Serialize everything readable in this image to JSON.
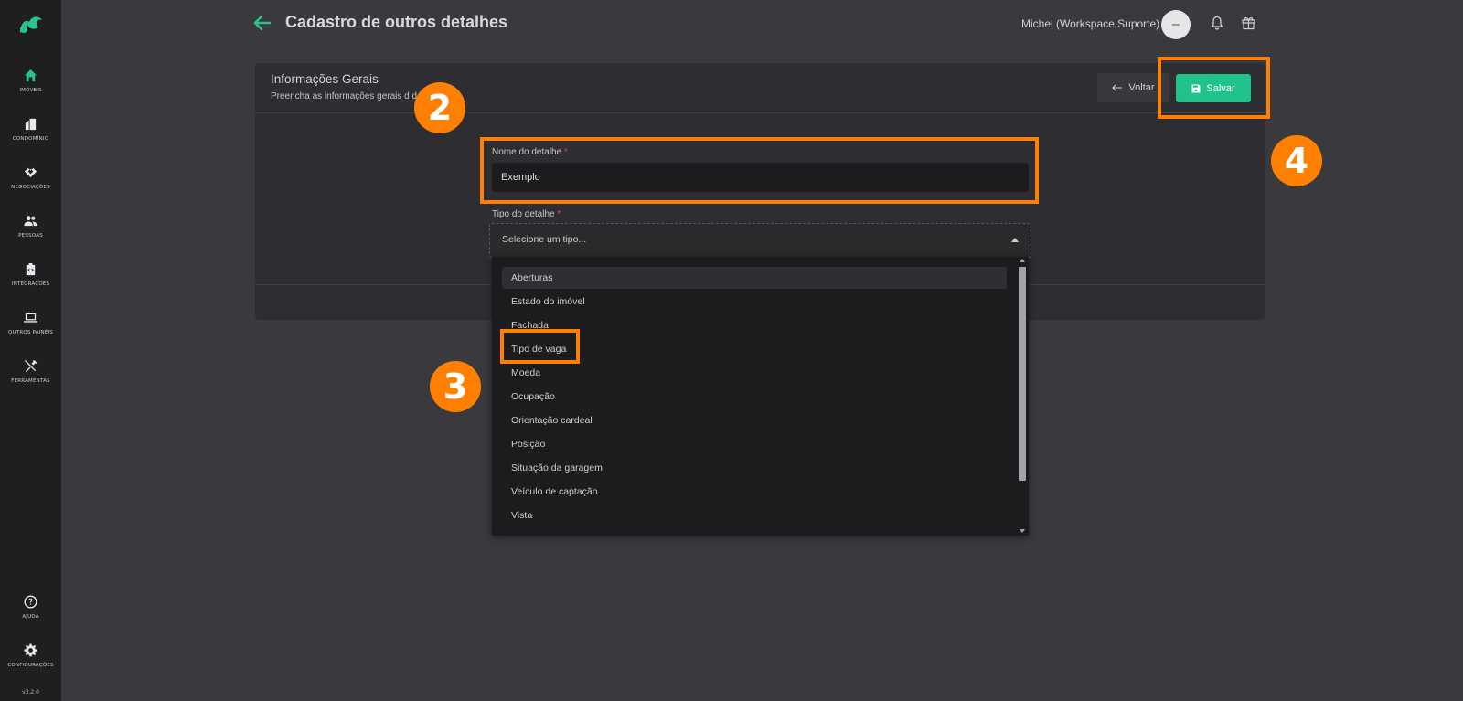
{
  "sidebar": {
    "items": [
      {
        "label": "IMÓVEIS",
        "icon": "home-icon"
      },
      {
        "label": "CONDOMÍNIO",
        "icon": "building-icon"
      },
      {
        "label": "NEGOCIAÇÕES",
        "icon": "handshake-icon"
      },
      {
        "label": "PESSOAS",
        "icon": "people-icon"
      },
      {
        "label": "INTEGRAÇÕES",
        "icon": "integration-icon"
      },
      {
        "label": "OUTROS PAINÉIS",
        "icon": "laptop-icon"
      },
      {
        "label": "FERRAMENTAS",
        "icon": "tools-icon"
      }
    ],
    "bottom": [
      {
        "label": "AJUDA",
        "icon": "help-icon"
      },
      {
        "label": "CONFIGURAÇÕES",
        "icon": "gear-icon"
      }
    ],
    "version": "v3.2.0"
  },
  "header": {
    "title": "Cadastro de outros detalhes",
    "user": "Michel (Workspace Suporte)"
  },
  "card": {
    "title": "Informações Gerais",
    "subtitle": "Preencha as informações gerais d          detalhe",
    "back_label": "Voltar",
    "save_label": "Salvar"
  },
  "form": {
    "name_label": "Nome do detalhe",
    "name_value": "Exemplo",
    "type_label": "Tipo do detalhe",
    "required_mark": "*",
    "type_placeholder": "Selecione um tipo...",
    "options": [
      "Aberturas",
      "Estado do imóvel",
      "Fachada",
      "Tipo de vaga",
      "Moeda",
      "Ocupação",
      "Orientação cardeal",
      "Posição",
      "Situação da garagem",
      "Veículo de captação",
      "Vista"
    ]
  },
  "annotations": {
    "two": "2",
    "three": "3",
    "four": "4"
  },
  "colors": {
    "accent": "#1fc28a",
    "highlight": "#ff8000",
    "required": "#e0455a"
  }
}
